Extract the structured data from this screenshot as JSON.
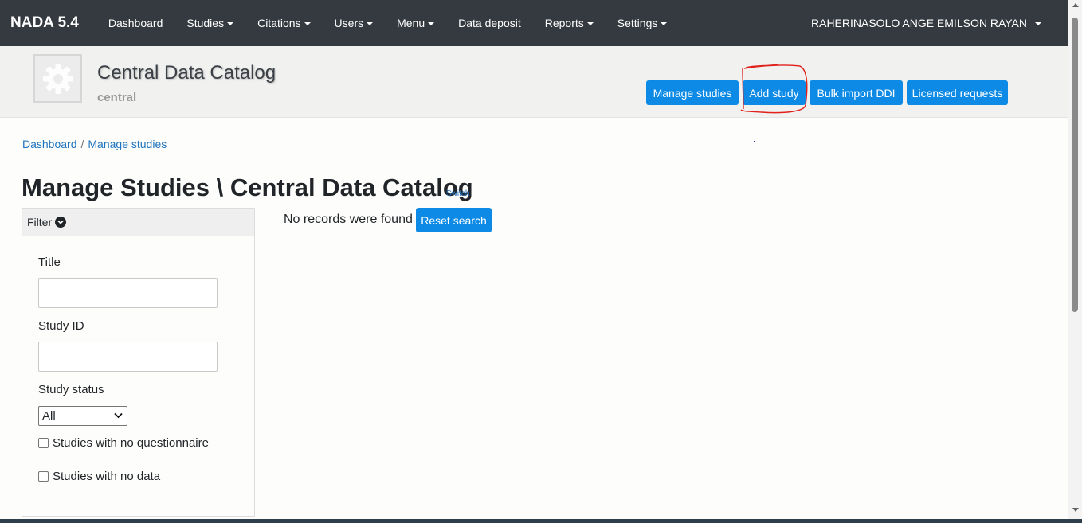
{
  "navbar": {
    "brand": "NADA 5.4",
    "items": [
      {
        "label": "Dashboard"
      },
      {
        "label": "Studies"
      },
      {
        "label": "Citations"
      },
      {
        "label": "Users"
      },
      {
        "label": "Menu"
      },
      {
        "label": "Data deposit"
      },
      {
        "label": "Reports"
      },
      {
        "label": "Settings"
      }
    ],
    "user": "RAHERINASOLO ANGE EMILSON RAYAN"
  },
  "catalog": {
    "title": "Central Data Catalog",
    "subtitle": "central",
    "logo_icon": "gear-icon",
    "buttons": {
      "manage": "Manage studies",
      "add": "Add study",
      "bulk": "Bulk import DDI",
      "licensed": "Licensed requests"
    },
    "annotation_color": "#e0201b"
  },
  "breadcrumb": {
    "items": [
      "Dashboard",
      "Manage studies"
    ],
    "separator": "/"
  },
  "page": {
    "title": "Manage Studies \\ Central Data Catalog",
    "switch_label": "Switch"
  },
  "filter": {
    "heading": "Filter",
    "title_label": "Title",
    "title_value": "",
    "study_id_label": "Study ID",
    "study_id_value": "",
    "status_label": "Study status",
    "status_selected": "All",
    "no_questionnaire_label": "Studies with no questionnaire",
    "no_data_label": "Studies with no data"
  },
  "results": {
    "message": "No records were found",
    "reset_label": "Reset search"
  },
  "colors": {
    "navbar_bg": "#343a40",
    "primary": "#0d8ae6",
    "link": "#1e73be"
  }
}
